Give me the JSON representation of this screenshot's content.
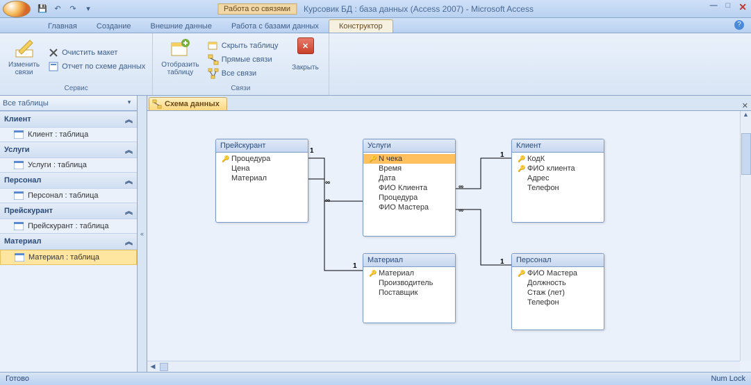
{
  "title_context_label": "Работа со связями",
  "app_title": "Курсовик БД : база данных (Access 2007) - Microsoft Access",
  "ribbon_tabs": {
    "home": "Главная",
    "create": "Создание",
    "external": "Внешние данные",
    "dbtools": "Работа с базами данных",
    "design": "Конструктор"
  },
  "ribbon": {
    "group1": {
      "title": "Сервис",
      "edit_rel": "Изменить\nсвязи",
      "clear_layout": "Очистить макет",
      "rel_report": "Отчет по схеме данных"
    },
    "group2": {
      "title": "Связи",
      "show_table": "Отобразить\nтаблицу",
      "hide_table": "Скрыть таблицу",
      "direct_rel": "Прямые связи",
      "all_rel": "Все связи",
      "close": "Закрыть"
    }
  },
  "nav": {
    "header": "Все таблицы",
    "sections": [
      {
        "name": "Клиент",
        "item": "Клиент : таблица"
      },
      {
        "name": "Услуги",
        "item": "Услуги : таблица"
      },
      {
        "name": "Персонал",
        "item": "Персонал : таблица"
      },
      {
        "name": "Прейскурант",
        "item": "Прейскурант : таблица"
      },
      {
        "name": "Материал",
        "item": "Материал : таблица"
      }
    ]
  },
  "doc_tab": "Схема данных",
  "tables": {
    "preiskurant": {
      "title": "Прейскурант",
      "f0": "Процедура",
      "f1": "Цена",
      "f2": "Материал"
    },
    "uslugi": {
      "title": "Услуги",
      "f0": "N чека",
      "f1": "Время",
      "f2": "Дата",
      "f3": "ФИО Клиента",
      "f4": "Процедура",
      "f5": "ФИО Мастера"
    },
    "klient": {
      "title": "Клиент",
      "f0": "КодК",
      "f1": "ФИО клиента",
      "f2": "Адрес",
      "f3": "Телефон"
    },
    "material": {
      "title": "Материал",
      "f0": "Материал",
      "f1": "Производитель",
      "f2": "Поставщик"
    },
    "personal": {
      "title": "Персонал",
      "f0": "ФИО Мастера",
      "f1": "Должность",
      "f2": "Стаж (лет)",
      "f3": "Телефон"
    }
  },
  "rel_labels": {
    "one": "1",
    "many": "∞"
  },
  "status": {
    "left": "Готово",
    "right": "Num Lock"
  }
}
